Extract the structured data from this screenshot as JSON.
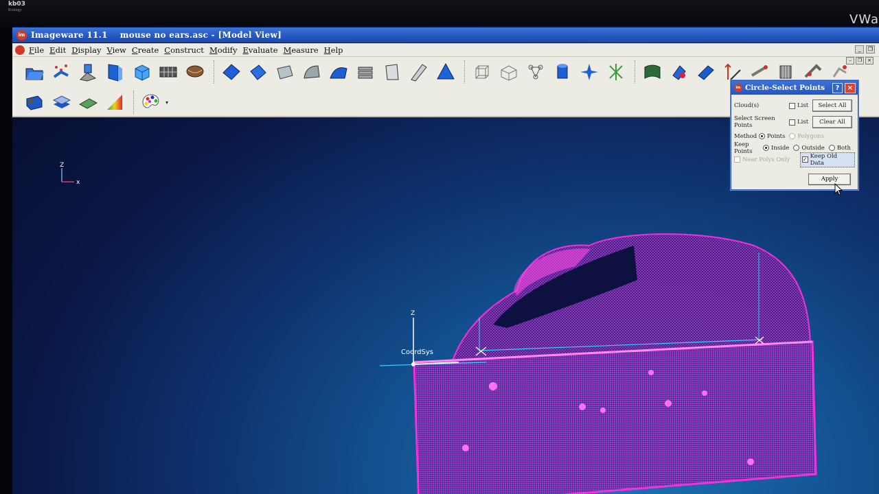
{
  "bezel": {
    "logo": "kb03",
    "logo_sub": "Ecology",
    "brand_partial": "VWa"
  },
  "window": {
    "app_name": "Imageware 11.1",
    "file": "mouse no ears.asc - [Model View]"
  },
  "menu": {
    "items": [
      {
        "key": "F",
        "rest": "ile"
      },
      {
        "key": "E",
        "rest": "dit"
      },
      {
        "key": "D",
        "rest": "isplay"
      },
      {
        "key": "V",
        "rest": "iew"
      },
      {
        "key": "C",
        "rest": "reate"
      },
      {
        "key": "C",
        "rest": "onstruct"
      },
      {
        "key": "M",
        "rest": "odify"
      },
      {
        "key": "E",
        "rest": "valuate"
      },
      {
        "key": "M",
        "rest": "easure"
      },
      {
        "key": "H",
        "rest": "elp"
      }
    ]
  },
  "viewport": {
    "coord_label": "CoordSys",
    "axis_z": "Z",
    "axis_x": "x",
    "mini_z": "Z",
    "mini_x": "x"
  },
  "dialog": {
    "title": "Circle-Select Points",
    "cloud_label": "Cloud(s)",
    "list_label_1": "List",
    "select_all": "Select All",
    "screen_points_label": "Select Screen Points",
    "list_label_2": "List",
    "clear_all": "Clear All",
    "method_label": "Method",
    "method_points": "Points",
    "method_polygons": "Polygons",
    "keep_points_label": "Keep Points",
    "keep_inside": "Inside",
    "keep_outside": "Outside",
    "keep_both": "Both",
    "near_polys": "Near Polys Only",
    "keep_old": "Keep Old Data",
    "apply": "Apply",
    "help": "?",
    "close": "×"
  },
  "colors": {
    "point_cloud": "#ff2fe0",
    "title_bar": "#2357c2",
    "axis_line": "#35d2ff"
  }
}
